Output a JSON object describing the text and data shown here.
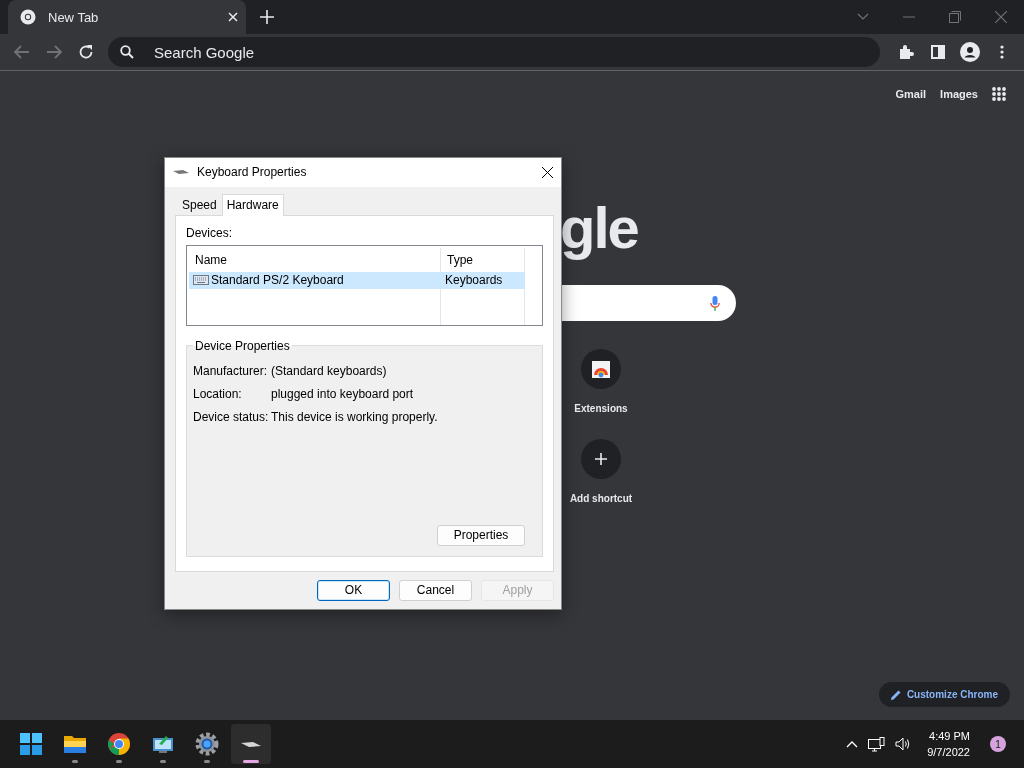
{
  "browser": {
    "tab": {
      "title": "New Tab",
      "selected": true
    },
    "omnibox": {
      "placeholder": "Search Google"
    },
    "header_links": [
      "Gmail",
      "Images"
    ],
    "logo_text": "gle",
    "shortcuts": [
      {
        "label": "Extensions",
        "kind": "extensions"
      },
      {
        "label": "Add shortcut",
        "kind": "add"
      }
    ],
    "customize_button": "Customize Chrome"
  },
  "dialog": {
    "title": "Keyboard Properties",
    "tabs": [
      {
        "label": "Speed",
        "selected": false
      },
      {
        "label": "Hardware",
        "selected": true
      }
    ],
    "devices_label": "Devices:",
    "columns": [
      "Name",
      "Type"
    ],
    "rows": [
      {
        "name": "Standard PS/2 Keyboard",
        "type": "Keyboards",
        "selected": true
      }
    ],
    "group_title": "Device Properties",
    "properties": [
      {
        "label": "Manufacturer:",
        "value": "(Standard keyboards)"
      },
      {
        "label": "Location:",
        "value": "plugged into keyboard port"
      },
      {
        "label": "Device status:",
        "value": "This device is working properly."
      }
    ],
    "properties_button": "Properties",
    "buttons": [
      {
        "label": "OK",
        "kind": "default",
        "disabled": false
      },
      {
        "label": "Cancel",
        "kind": "normal",
        "disabled": false
      },
      {
        "label": "Apply",
        "kind": "normal",
        "disabled": true
      }
    ]
  },
  "taskbar": {
    "apps": [
      {
        "kind": "start",
        "running": false,
        "selected": false
      },
      {
        "kind": "folder",
        "running": true,
        "selected": false
      },
      {
        "kind": "chrome",
        "running": true,
        "selected": false
      },
      {
        "kind": "monitor",
        "running": true,
        "selected": false
      },
      {
        "kind": "gear",
        "running": true,
        "selected": false
      },
      {
        "kind": "keyboard",
        "running": true,
        "selected": true
      }
    ],
    "time": "4:49 PM",
    "date": "9/7/2022",
    "notification_count": "1"
  }
}
